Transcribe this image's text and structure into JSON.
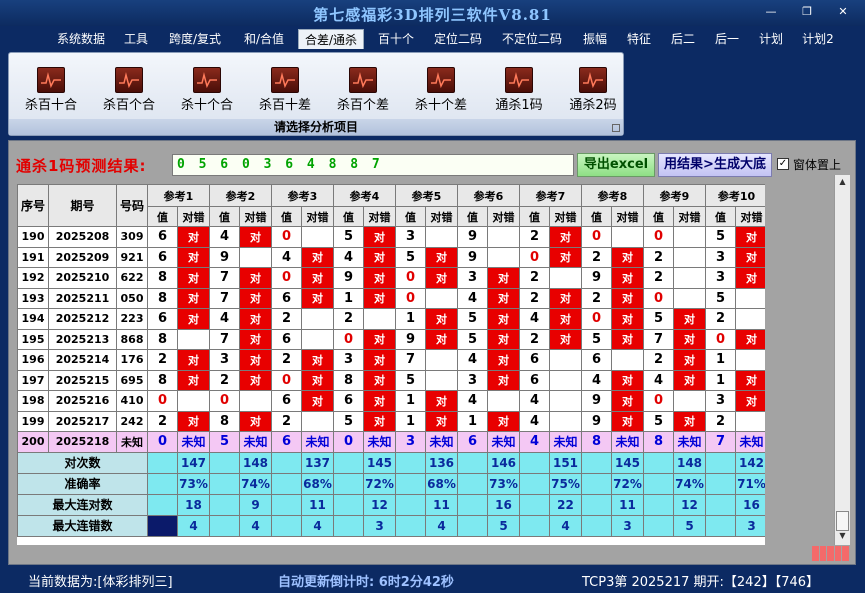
{
  "window": {
    "title": "第七感福彩3D排列三软件V8.81"
  },
  "menu": [
    "系统数据",
    "工具",
    "跨度/复式",
    "和/合值",
    "合差/通杀",
    "百十个",
    "定位二码",
    "不定位二码",
    "振幅",
    "特征",
    "后二",
    "后一",
    "计划",
    "计划2"
  ],
  "menu_active_index": 4,
  "ribbon": {
    "buttons": [
      "杀百十合",
      "杀百个合",
      "杀十个合",
      "杀百十差",
      "杀百个差",
      "杀十个差",
      "通杀1码",
      "通杀2码"
    ],
    "caption": "请选择分析项目"
  },
  "prediction": {
    "label": "通杀1码预测结果:",
    "value": "0 5 6 0 3 6 4 8 8 7",
    "export_button": "导出excel",
    "generate_button": "用结果>生成大底",
    "topmost_checkbox": {
      "label": "窗体置上",
      "checked": true
    }
  },
  "table": {
    "headers": {
      "index": "序号",
      "period": "期号",
      "number": "号码"
    },
    "refs": [
      "参考1",
      "参考2",
      "参考3",
      "参考4",
      "参考5",
      "参考6",
      "参考7",
      "参考8",
      "参考9",
      "参考10"
    ],
    "sub_headers": {
      "value": "值",
      "judge": "对错"
    },
    "yes_mark": "对",
    "rows": [
      {
        "idx": "190",
        "period": "2025208",
        "num": "309",
        "vals": [
          "6",
          "4",
          "0",
          "5",
          "3",
          "9",
          "2",
          "0",
          "0",
          "5"
        ],
        "hits": [
          1,
          1,
          0,
          1,
          0,
          0,
          1,
          0,
          0,
          1
        ]
      },
      {
        "idx": "191",
        "period": "2025209",
        "num": "921",
        "vals": [
          "6",
          "9",
          "4",
          "4",
          "5",
          "9",
          "0",
          "2",
          "2",
          "3"
        ],
        "hits": [
          1,
          0,
          1,
          1,
          1,
          0,
          1,
          1,
          0,
          1
        ]
      },
      {
        "idx": "192",
        "period": "2025210",
        "num": "622",
        "vals": [
          "8",
          "7",
          "0",
          "9",
          "0",
          "3",
          "2",
          "9",
          "2",
          "3"
        ],
        "hits": [
          1,
          1,
          1,
          1,
          1,
          1,
          0,
          1,
          0,
          1
        ]
      },
      {
        "idx": "193",
        "period": "2025211",
        "num": "050",
        "vals": [
          "8",
          "7",
          "6",
          "1",
          "0",
          "4",
          "2",
          "2",
          "0",
          "5"
        ],
        "hits": [
          1,
          1,
          1,
          1,
          0,
          1,
          1,
          1,
          0,
          0
        ]
      },
      {
        "idx": "194",
        "period": "2025212",
        "num": "223",
        "vals": [
          "6",
          "4",
          "2",
          "2",
          "1",
          "5",
          "4",
          "0",
          "5",
          "2"
        ],
        "hits": [
          1,
          1,
          0,
          0,
          1,
          1,
          1,
          1,
          1,
          0
        ]
      },
      {
        "idx": "195",
        "period": "2025213",
        "num": "868",
        "vals": [
          "8",
          "7",
          "6",
          "0",
          "9",
          "5",
          "2",
          "5",
          "7",
          "0"
        ],
        "hits": [
          0,
          1,
          0,
          1,
          1,
          1,
          1,
          1,
          1,
          1
        ]
      },
      {
        "idx": "196",
        "period": "2025214",
        "num": "176",
        "vals": [
          "2",
          "3",
          "2",
          "3",
          "7",
          "4",
          "6",
          "6",
          "2",
          "1"
        ],
        "hits": [
          1,
          1,
          1,
          1,
          0,
          1,
          0,
          0,
          1,
          0
        ]
      },
      {
        "idx": "197",
        "period": "2025215",
        "num": "695",
        "vals": [
          "8",
          "2",
          "0",
          "8",
          "5",
          "3",
          "6",
          "4",
          "4",
          "1"
        ],
        "hits": [
          1,
          1,
          1,
          1,
          0,
          1,
          0,
          1,
          1,
          1
        ]
      },
      {
        "idx": "198",
        "period": "2025216",
        "num": "410",
        "vals": [
          "0",
          "0",
          "6",
          "6",
          "1",
          "4",
          "4",
          "9",
          "0",
          "3"
        ],
        "hits": [
          0,
          0,
          1,
          1,
          1,
          0,
          0,
          1,
          0,
          1
        ]
      },
      {
        "idx": "199",
        "period": "2025217",
        "num": "242",
        "vals": [
          "2",
          "8",
          "2",
          "5",
          "1",
          "1",
          "4",
          "9",
          "5",
          "2"
        ],
        "hits": [
          1,
          1,
          0,
          1,
          1,
          1,
          0,
          1,
          1,
          0
        ]
      }
    ],
    "predict_row": {
      "idx": "200",
      "period": "2025218",
      "num": "未知",
      "vals": [
        "0",
        "5",
        "6",
        "0",
        "3",
        "6",
        "4",
        "8",
        "8",
        "7"
      ],
      "status": "未知"
    },
    "stats": [
      {
        "label": "对次数",
        "vals": [
          "147",
          "148",
          "137",
          "145",
          "136",
          "146",
          "151",
          "145",
          "148",
          "142"
        ]
      },
      {
        "label": "准确率",
        "vals": [
          "73%",
          "74%",
          "68%",
          "72%",
          "68%",
          "73%",
          "75%",
          "72%",
          "74%",
          "71%"
        ]
      },
      {
        "label": "最大连对数",
        "vals": [
          "18",
          "9",
          "11",
          "12",
          "11",
          "16",
          "22",
          "11",
          "12",
          "16"
        ]
      },
      {
        "label": "最大连错数",
        "vals": [
          "4",
          "4",
          "4",
          "3",
          "4",
          "5",
          "4",
          "3",
          "5",
          "3"
        ]
      }
    ]
  },
  "status": {
    "current_data": "当前数据为:[体彩排列三]",
    "countdown": "自动更新倒计时: 6时2分42秒",
    "draw_info": "TCP3第 2025217 期开:【242】【746】"
  },
  "colors": {
    "hit_red": "#e80000",
    "predict_row": "#f4c8f4",
    "stats_cyan": "#7ee9f0",
    "title_blue": "#8fc6ff"
  }
}
